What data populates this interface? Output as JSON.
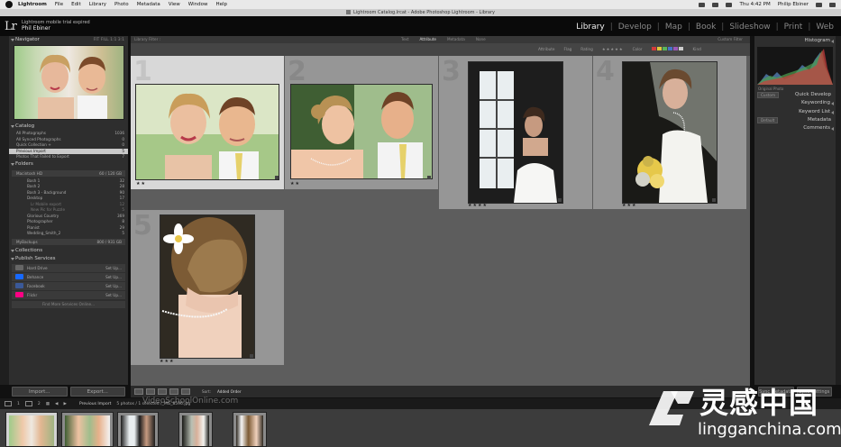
{
  "menubar": {
    "app": "Lightroom",
    "items": [
      "File",
      "Edit",
      "Library",
      "Photo",
      "Metadata",
      "View",
      "Window",
      "Help"
    ],
    "clock": "Thu 4:42 PM",
    "user": "Philip Ebiner"
  },
  "window_title": "Lightroom Catalog.lrcat - Adobe Photoshop Lightroom - Library",
  "identity": {
    "logo": "Lr",
    "line1": "Lightroom mobile trial expired",
    "line2": "Phil Ebiner"
  },
  "modules": [
    "Library",
    "Develop",
    "Map",
    "Book",
    "Slideshow",
    "Print",
    "Web"
  ],
  "active_module": "Library",
  "left_panel": {
    "navigator_label": "Navigator",
    "navigator_zoom": "FIT  FILL  1:1  3:1",
    "catalog_label": "Catalog",
    "catalog_items": [
      {
        "label": "All Photographs",
        "count": "1036",
        "selected": false
      },
      {
        "label": "All Synced Photographs",
        "count": "0",
        "selected": false
      },
      {
        "label": "Quick Collection +",
        "count": "0",
        "selected": false
      },
      {
        "label": "Previous Import",
        "count": "5",
        "selected": true
      },
      {
        "label": "Photos That Failed to Export",
        "count": "7",
        "selected": false
      }
    ],
    "folders_label": "Folders",
    "drive1": {
      "label": "Macintosh HD",
      "size": "60 / 120 GB"
    },
    "folders": [
      {
        "label": "Bash 1",
        "count": "32",
        "level": 1
      },
      {
        "label": "Bash 2",
        "count": "28",
        "level": 1
      },
      {
        "label": "Bash 3 - Background",
        "count": "90",
        "level": 1
      },
      {
        "label": "Desktop",
        "count": "17",
        "level": 1
      },
      {
        "label": "Lr Mobile export",
        "count": "12",
        "level": 2
      },
      {
        "label": "New Pic for Puzzle",
        "count": "5",
        "level": 2
      },
      {
        "label": "Glorious Country",
        "count": "369",
        "level": 1
      },
      {
        "label": "Photographer",
        "count": "8",
        "level": 1
      },
      {
        "label": "Pianist",
        "count": "29",
        "level": 1
      },
      {
        "label": "Wedding_Smith_2",
        "count": "5",
        "level": 1
      }
    ],
    "drive2": {
      "label": "MyBackups",
      "size": "800 / 931 GB"
    },
    "collections_label": "Collections",
    "publish_label": "Publish Services",
    "publish_services": [
      {
        "label": "Hard Drive",
        "action": "Set Up...",
        "color": "#666666"
      },
      {
        "label": "Behance",
        "action": "Set Up...",
        "color": "#1769ff"
      },
      {
        "label": "Facebook",
        "action": "Set Up...",
        "color": "#3b5998"
      },
      {
        "label": "Flickr",
        "action": "Set Up...",
        "color": "#ff0084"
      }
    ],
    "find_more": "Find More Services Online...",
    "import_btn": "Import...",
    "export_btn": "Export..."
  },
  "center": {
    "filter_label": "Library Filter :",
    "filter_tabs": [
      "Text",
      "Attribute",
      "Metadata",
      "None"
    ],
    "filter_active": "Attribute",
    "filter_right": "Custom Filter",
    "attr_label": "Attribute",
    "attr_flag": "Flag",
    "attr_rating": "Rating",
    "attr_stars": "★★★★★",
    "attr_color": "Color",
    "attr_kind": "Kind",
    "swatches": [
      "#d23b3b",
      "#e0c93a",
      "#5ab55a",
      "#4673c9",
      "#9b59b6",
      "#cccccc"
    ],
    "cells": [
      {
        "num": "1",
        "dots": "★★"
      },
      {
        "num": "2",
        "dots": "★★"
      },
      {
        "num": "3",
        "dots": "★★★★"
      },
      {
        "num": "4",
        "dots": "★★★"
      },
      {
        "num": "5",
        "dots": "★★★"
      }
    ],
    "sort_label": "Sort:",
    "sort_value": "Added Order",
    "watermark": "VideoSchoolOnline.com"
  },
  "right_panel": {
    "histogram_label": "Histogram",
    "original_photo": "Original Photo",
    "quick_develop_label": "Quick Develop",
    "quick_develop_preset": "Custom",
    "keywording_label": "Keywording",
    "keyword_list_label": "Keyword List",
    "metadata_label": "Metadata",
    "metadata_preset": "Default",
    "comments_label": "Comments",
    "sync_metadata": "Sync Metadata",
    "sync_settings": "Sync Settings"
  },
  "filmstrip": {
    "page_1": "1",
    "page_2": "2",
    "source": "Previous Import",
    "count_text": "5 photos / 1 selected /_MG_8596.jpg"
  },
  "brand": {
    "cn": "灵感中国",
    "en": "lingganchina.com"
  }
}
